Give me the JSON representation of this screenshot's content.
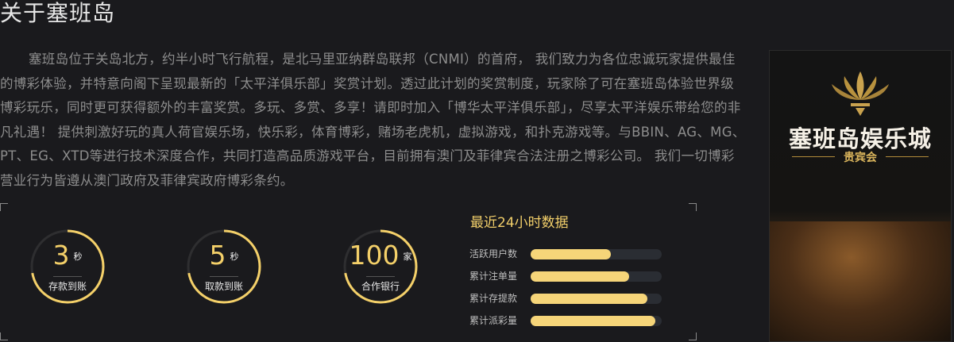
{
  "page": {
    "title": "关于塞班岛",
    "intro": "塞班岛位于关岛北方，约半小时飞行航程，是北马里亚纳群岛联邦（CNMI）的首府， 我们致力为各位忠诚玩家提供最佳的博彩体验，并特意向阁下呈现最新的「太平洋俱乐部」奖赏计划。透过此计划的奖赏制度，玩家除了可在塞班岛体验世界级博彩玩乐，同时更可获得额外的丰富奖赏。多玩、多赏、多享！请即时加入「博华太平洋俱乐部」，尽享太平洋娱乐带给您的非凡礼遇！ 提供刺激好玩的真人荷官娱乐场，快乐彩，体育博彩，赌场老虎机，虚拟游戏，和扑克游戏等。与BBIN、AG、MG、PT、EG、XTD等进行技术深度合作，共同打造高品质游戏平台，目前拥有澳门及菲律宾合法注册之博彩公司。 我们一切博彩营业行为皆遵从澳门政府及菲律宾政府博彩条约。"
  },
  "stats": {
    "rings": [
      {
        "value": "3",
        "unit": "秒",
        "label": "存款到账",
        "fill": 0.72
      },
      {
        "value": "5",
        "unit": "秒",
        "label": "取款到账",
        "fill": 0.72
      },
      {
        "value": "100",
        "unit": "家",
        "label": "合作银行",
        "fill": 0.72
      }
    ],
    "data_title": "最近24小时数据",
    "bars": [
      {
        "label": "活跃用户数",
        "fraction": 0.61
      },
      {
        "label": "累计注单量",
        "fraction": 0.75
      },
      {
        "label": "累计存提款",
        "fraction": 0.89
      },
      {
        "label": "累计派彩量",
        "fraction": 0.95
      }
    ]
  },
  "promo": {
    "logo_text": "塞班岛娱乐城",
    "subtitle": "贵宾会"
  },
  "colors": {
    "accent_gold": "#f4d069",
    "bar_fill": "#f6d579",
    "background": "#1a1a1d"
  }
}
